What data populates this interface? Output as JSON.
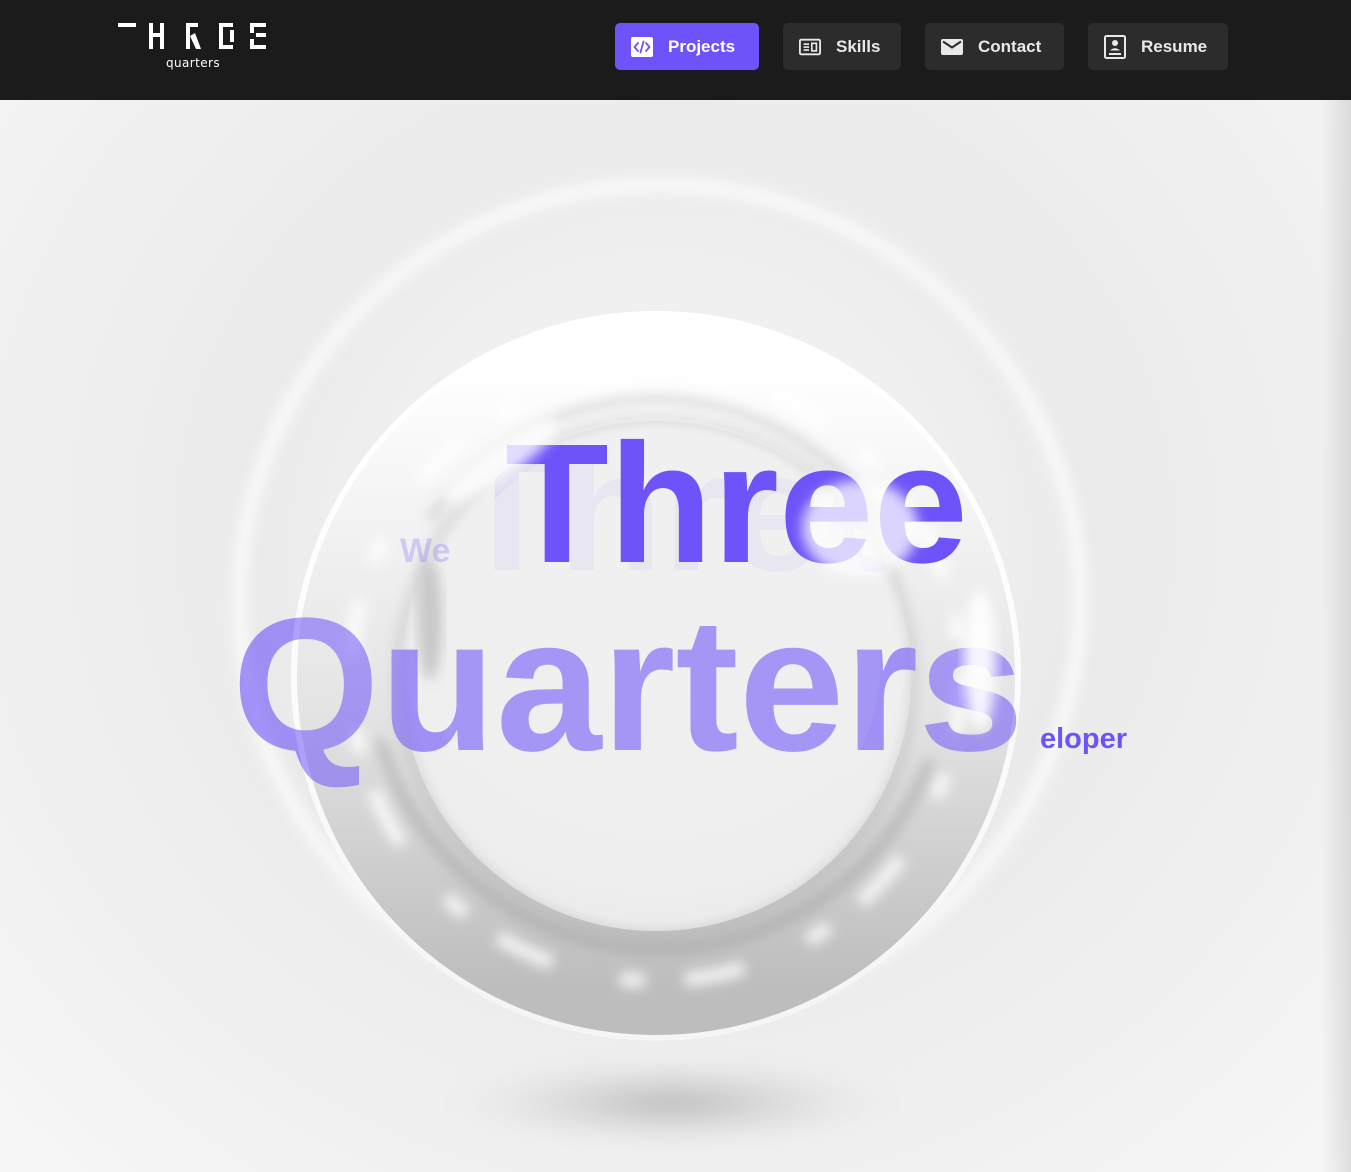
{
  "brand": {
    "logo_text": "THREE",
    "logo_subtitle": "quarters"
  },
  "nav": {
    "items": [
      {
        "label": "Projects",
        "icon": "code-icon",
        "active": true
      },
      {
        "label": "Skills",
        "icon": "card-list-icon",
        "active": false
      },
      {
        "label": "Contact",
        "icon": "mail-icon",
        "active": false
      },
      {
        "label": "Resume",
        "icon": "resume-icon",
        "active": false
      }
    ]
  },
  "hero": {
    "title_line1": "Three",
    "title_line2": "Quarters",
    "intro_word": "We",
    "role_fragment": "eloper"
  },
  "colors": {
    "accent": "#6e53fa",
    "header_bg": "#1b1b1b",
    "button_bg": "#2c2c2c",
    "hero_bg": "#ededed"
  }
}
